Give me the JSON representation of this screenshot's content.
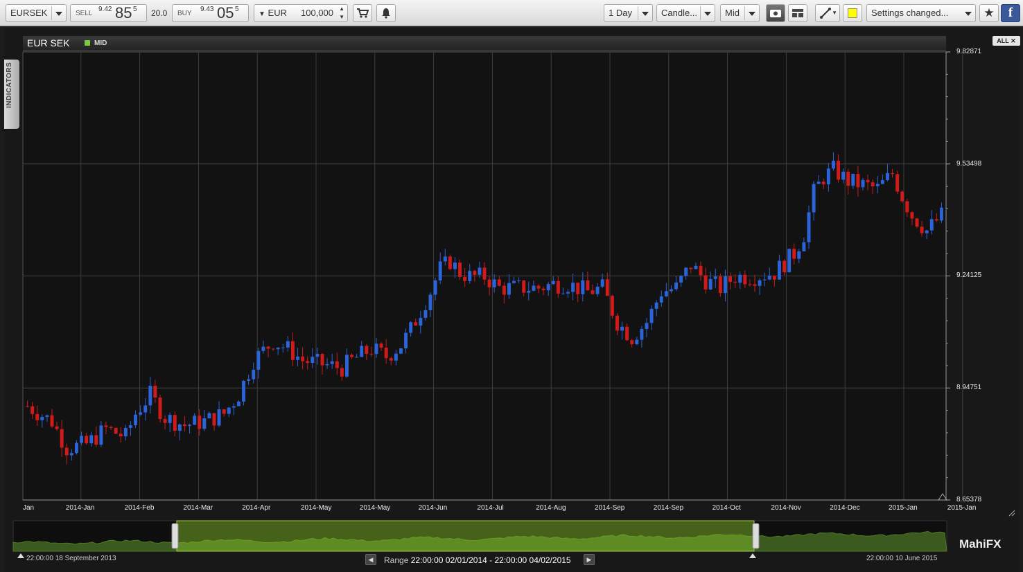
{
  "toolbar": {
    "symbol": "EURSEK",
    "sell_label": "SELL",
    "sell_big_prefix": "9.42",
    "sell_big": "85",
    "sell_pip": "5",
    "spread": "20.0",
    "buy_label": "BUY",
    "buy_big_prefix": "9.43",
    "buy_big": "05",
    "buy_pip": "5",
    "currency": "EUR",
    "amount": "100,000",
    "timeframe": "1 Day",
    "chart_type": "Candle...",
    "price_type": "Mid",
    "settings": "Settings changed...",
    "icons": [
      "cart-icon",
      "bell-icon",
      "camera-icon",
      "layout-icon",
      "line-tool-icon",
      "color-swatch-icon",
      "star-icon",
      "facebook-icon"
    ]
  },
  "chart": {
    "symbol": "EUR SEK",
    "series": "MID",
    "all_button": "ALL",
    "indicators_tab": "INDICATORS",
    "range_label": "Range",
    "range_value": "22:00:00 02/01/2014 - 22:00:00 04/02/2015",
    "nav_start": "22:00:00 18 September 2013",
    "nav_end": "22:00:00 10 June 2015",
    "brand": "MahiFX"
  },
  "chart_data": {
    "type": "candlestick",
    "title": "EUR SEK",
    "y_ticks": [
      "9.82871",
      "9.53498",
      "9.24125",
      "8.94751",
      "8.65378"
    ],
    "ylim": [
      8.65378,
      9.82871
    ],
    "x_ticks": [
      "Jan",
      "2014-Jan",
      "2014-Feb",
      "2014-Mar",
      "2014-Apr",
      "2014-May",
      "2014-May",
      "2014-Jun",
      "2014-Jul",
      "2014-Aug",
      "2014-Sep",
      "2014-Sep",
      "2014-Oct",
      "2014-Nov",
      "2014-Dec",
      "2015-Jan",
      "2015-Jan"
    ],
    "up_color": "#2b63d9",
    "down_color": "#d11a1a",
    "close_trend": [
      [
        0,
        8.9
      ],
      [
        5,
        8.86
      ],
      [
        8,
        8.79
      ],
      [
        12,
        8.8
      ],
      [
        16,
        8.84
      ],
      [
        20,
        8.82
      ],
      [
        22,
        8.88
      ],
      [
        25,
        8.93
      ],
      [
        28,
        8.87
      ],
      [
        32,
        8.85
      ],
      [
        36,
        8.86
      ],
      [
        40,
        8.88
      ],
      [
        43,
        8.93
      ],
      [
        46,
        9.02
      ],
      [
        50,
        9.07
      ],
      [
        53,
        9.05
      ],
      [
        56,
        9.02
      ],
      [
        60,
        9.01
      ],
      [
        64,
        9.0
      ],
      [
        66,
        9.02
      ],
      [
        70,
        9.05
      ],
      [
        73,
        9.03
      ],
      [
        76,
        9.06
      ],
      [
        78,
        9.1
      ],
      [
        80,
        9.15
      ],
      [
        82,
        9.2
      ],
      [
        84,
        9.26
      ],
      [
        86,
        9.28
      ],
      [
        88,
        9.25
      ],
      [
        90,
        9.24
      ],
      [
        93,
        9.24
      ],
      [
        96,
        9.21
      ],
      [
        100,
        9.21
      ],
      [
        104,
        9.21
      ],
      [
        107,
        9.22
      ],
      [
        110,
        9.22
      ],
      [
        114,
        9.2
      ],
      [
        117,
        9.21
      ],
      [
        120,
        9.12
      ],
      [
        123,
        9.08
      ],
      [
        126,
        9.12
      ],
      [
        129,
        9.2
      ],
      [
        132,
        9.21
      ],
      [
        135,
        9.27
      ],
      [
        138,
        9.23
      ],
      [
        141,
        9.21
      ],
      [
        144,
        9.24
      ],
      [
        148,
        9.24
      ],
      [
        152,
        9.25
      ],
      [
        156,
        9.3
      ],
      [
        158,
        9.35
      ],
      [
        160,
        9.46
      ],
      [
        162,
        9.5
      ],
      [
        164,
        9.52
      ],
      [
        167,
        9.49
      ],
      [
        170,
        9.48
      ],
      [
        173,
        9.47
      ],
      [
        176,
        9.51
      ],
      [
        178,
        9.45
      ],
      [
        180,
        9.4
      ],
      [
        183,
        9.36
      ],
      [
        186,
        9.4
      ]
    ]
  }
}
